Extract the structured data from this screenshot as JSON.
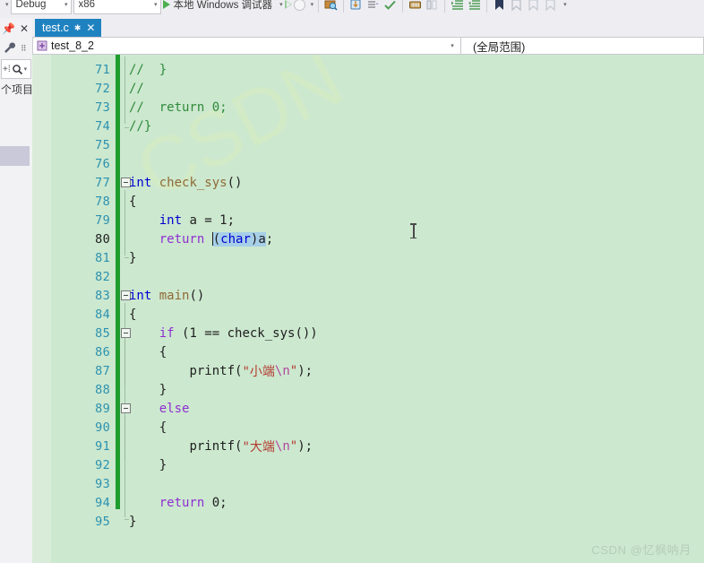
{
  "toolbar": {
    "config_combo": "Debug",
    "platform_combo": "x86",
    "run_label": "本地 Windows 调试器",
    "icons": [
      "start-debug-green-triangle-icon",
      "attach-hollow-triangle-icon",
      "stop-circle-icon",
      "magnifier-window-icon",
      "step-into-icon",
      "step-options-icon",
      "checkmark-icon",
      "memory-window-icon",
      "columns-icon",
      "indent-increase-icon",
      "indent-decrease-icon",
      "bookmark-filled-icon",
      "bookmark-icon",
      "bookmark-prev-icon",
      "bookmark-next-icon",
      "overflow-chevron-icon"
    ]
  },
  "left_panel": {
    "pin_icon": "pin-icon",
    "close_icon": "close-icon",
    "wrench_icon": "wrench-icon",
    "overflow_icon": "overflow-dots-icon",
    "add_icon": "add-icon",
    "search_icon": "search-icon",
    "search_caret_icon": "chevron-down-icon",
    "label": "个项目"
  },
  "tab": {
    "title": "test.c",
    "modified_marker": "✱",
    "pin_icon": "pin-icon",
    "close_icon": "close-icon"
  },
  "navbar": {
    "project_icon": "project-scope-icon",
    "scope_left": "test_8_2",
    "caret_icon": "chevron-down-icon",
    "scope_right": "(全局范围)"
  },
  "editor": {
    "theme": {
      "background": "#cce8cf",
      "breakpoint_margin": "#d9ecda",
      "line_number": "#2b91af",
      "current_line_number": "#1c1c1c",
      "change_bar": "#1f9d2f",
      "comment": "#2f8a3a",
      "keyword": "#0000d0",
      "control_keyword": "#8f2fd0",
      "function": "#8f6a35",
      "string": "#b33a2f",
      "escape": "#b3489e",
      "selection": "#a6cfe8"
    },
    "current_line": 80,
    "first_visible_line": 71,
    "lines": [
      {
        "n": 71,
        "indent": 0,
        "tokens": [
          {
            "t": "//  }",
            "c": "cmt"
          }
        ]
      },
      {
        "n": 72,
        "indent": 0,
        "tokens": [
          {
            "t": "//",
            "c": "cmt"
          }
        ]
      },
      {
        "n": 73,
        "indent": 0,
        "tokens": [
          {
            "t": "//  return 0;",
            "c": "cmt"
          }
        ]
      },
      {
        "n": 74,
        "indent": 0,
        "tokens": [
          {
            "t": "//}",
            "c": "cmt"
          }
        ]
      },
      {
        "n": 75,
        "indent": 0,
        "tokens": []
      },
      {
        "n": 76,
        "indent": 0,
        "tokens": []
      },
      {
        "n": 77,
        "indent": 0,
        "tokens": [
          {
            "t": "int",
            "c": "kw"
          },
          {
            "t": " ",
            "c": "pl"
          },
          {
            "t": "check_sys",
            "c": "fn"
          },
          {
            "t": "()",
            "c": "pl"
          }
        ]
      },
      {
        "n": 78,
        "indent": 0,
        "tokens": [
          {
            "t": "{",
            "c": "pl"
          }
        ]
      },
      {
        "n": 79,
        "indent": 1,
        "tokens": [
          {
            "t": "int",
            "c": "kw"
          },
          {
            "t": " a = ",
            "c": "pl"
          },
          {
            "t": "1",
            "c": "num"
          },
          {
            "t": ";",
            "c": "pl"
          }
        ]
      },
      {
        "n": 80,
        "indent": 1,
        "tokens": [
          {
            "t": "return",
            "c": "kwp"
          },
          {
            "t": " ",
            "c": "pl"
          },
          {
            "t": "CARET",
            "c": "caret"
          },
          {
            "t": "(",
            "c": "sel pl"
          },
          {
            "t": "char",
            "c": "sel kw"
          },
          {
            "t": ")a",
            "c": "sel pl"
          },
          {
            "t": ";",
            "c": "pl"
          }
        ]
      },
      {
        "n": 81,
        "indent": 0,
        "tokens": [
          {
            "t": "}",
            "c": "pl"
          }
        ]
      },
      {
        "n": 82,
        "indent": 0,
        "tokens": []
      },
      {
        "n": 83,
        "indent": 0,
        "tokens": [
          {
            "t": "int",
            "c": "kw"
          },
          {
            "t": " ",
            "c": "pl"
          },
          {
            "t": "main",
            "c": "fn"
          },
          {
            "t": "()",
            "c": "pl"
          }
        ]
      },
      {
        "n": 84,
        "indent": 0,
        "tokens": [
          {
            "t": "{",
            "c": "pl"
          }
        ]
      },
      {
        "n": 85,
        "indent": 1,
        "tokens": [
          {
            "t": "if",
            "c": "kwp"
          },
          {
            "t": " (",
            "c": "pl"
          },
          {
            "t": "1",
            "c": "num"
          },
          {
            "t": " == check_sys())",
            "c": "pl"
          }
        ]
      },
      {
        "n": 86,
        "indent": 1,
        "tokens": [
          {
            "t": "{",
            "c": "pl"
          }
        ]
      },
      {
        "n": 87,
        "indent": 2,
        "tokens": [
          {
            "t": "printf(",
            "c": "pl"
          },
          {
            "t": "\"小端",
            "c": "str"
          },
          {
            "t": "\\n",
            "c": "esc"
          },
          {
            "t": "\"",
            "c": "str"
          },
          {
            "t": ");",
            "c": "pl"
          }
        ]
      },
      {
        "n": 88,
        "indent": 1,
        "tokens": [
          {
            "t": "}",
            "c": "pl"
          }
        ]
      },
      {
        "n": 89,
        "indent": 1,
        "tokens": [
          {
            "t": "else",
            "c": "kwp"
          }
        ]
      },
      {
        "n": 90,
        "indent": 1,
        "tokens": [
          {
            "t": "{",
            "c": "pl"
          }
        ]
      },
      {
        "n": 91,
        "indent": 2,
        "tokens": [
          {
            "t": "printf(",
            "c": "pl"
          },
          {
            "t": "\"大端",
            "c": "str"
          },
          {
            "t": "\\n",
            "c": "esc"
          },
          {
            "t": "\"",
            "c": "str"
          },
          {
            "t": ");",
            "c": "pl"
          }
        ]
      },
      {
        "n": 92,
        "indent": 1,
        "tokens": [
          {
            "t": "}",
            "c": "pl"
          }
        ]
      },
      {
        "n": 93,
        "indent": 0,
        "tokens": []
      },
      {
        "n": 94,
        "indent": 1,
        "tokens": [
          {
            "t": "return",
            "c": "kwp"
          },
          {
            "t": " ",
            "c": "pl"
          },
          {
            "t": "0",
            "c": "num"
          },
          {
            "t": ";",
            "c": "pl"
          }
        ]
      },
      {
        "n": 95,
        "indent": 0,
        "tokens": [
          {
            "t": "}",
            "c": "pl"
          }
        ]
      }
    ]
  },
  "watermark": {
    "text": "CSDN @忆枫呐月",
    "big_text": "CSDN"
  }
}
